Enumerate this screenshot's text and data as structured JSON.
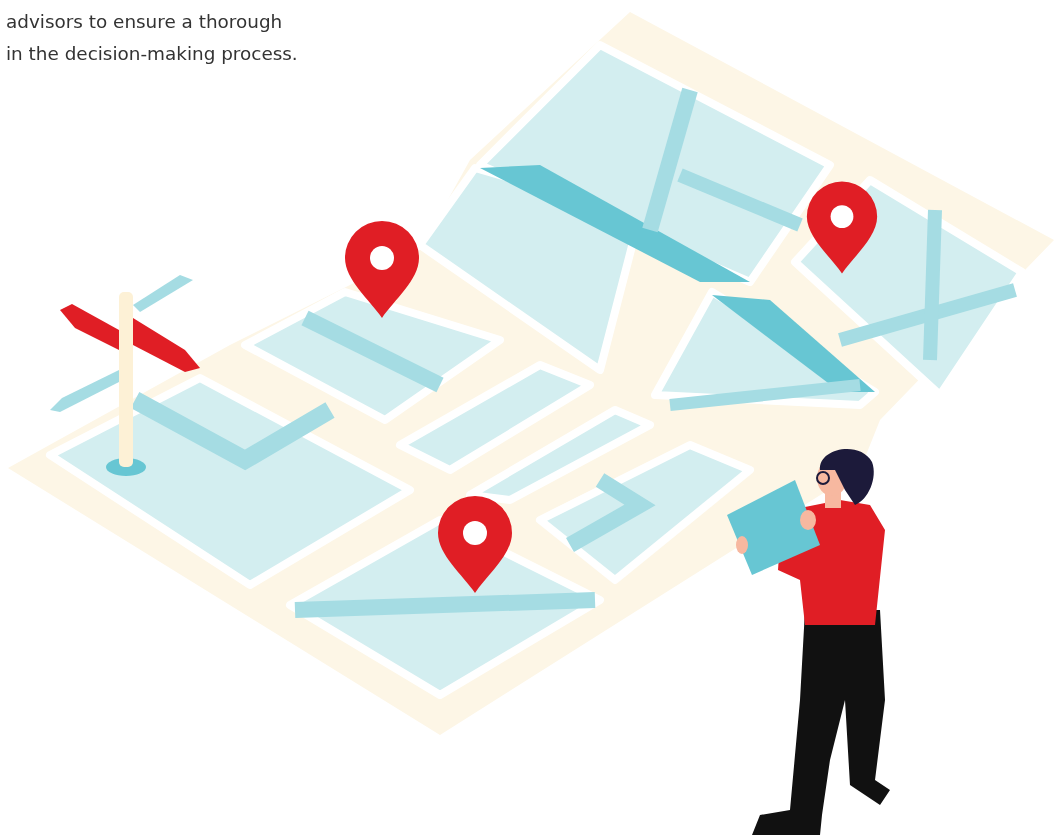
{
  "paragraph_lines": [
    "advisors to ensure a thorough",
    "in the decision-making process."
  ]
}
